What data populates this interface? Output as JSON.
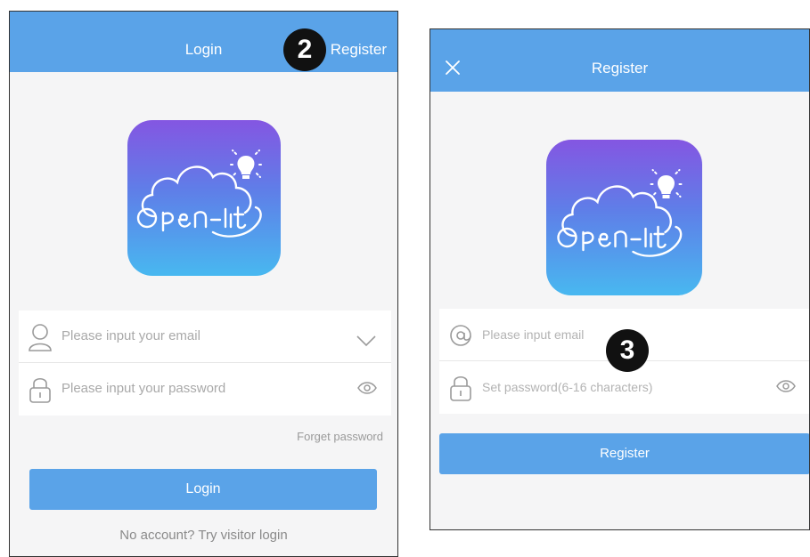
{
  "login_screen": {
    "title": "Login",
    "register_link": "Register",
    "email_placeholder": "Please input your email",
    "password_placeholder": "Please input your password",
    "forget_password": "Forget password",
    "login_button": "Login",
    "visitor_login": "No account? Try visitor login"
  },
  "register_screen": {
    "title": "Register",
    "email_placeholder": "Please input email",
    "password_placeholder": "Set password(6-16 characters)",
    "register_button": "Register"
  },
  "logo": {
    "brand_text": "Open-lit"
  },
  "badges": {
    "step_2": "2",
    "step_3": "3"
  },
  "icons": [
    "close-icon",
    "user-icon",
    "lock-icon",
    "at-icon",
    "chevron-down-icon",
    "eye-icon",
    "lightbulb-icon",
    "cloud-icon"
  ],
  "colors": {
    "accent": "#5aa3e8",
    "logo_top": "#8456e2",
    "logo_bottom": "#48b8f0",
    "badge": "#111111"
  }
}
